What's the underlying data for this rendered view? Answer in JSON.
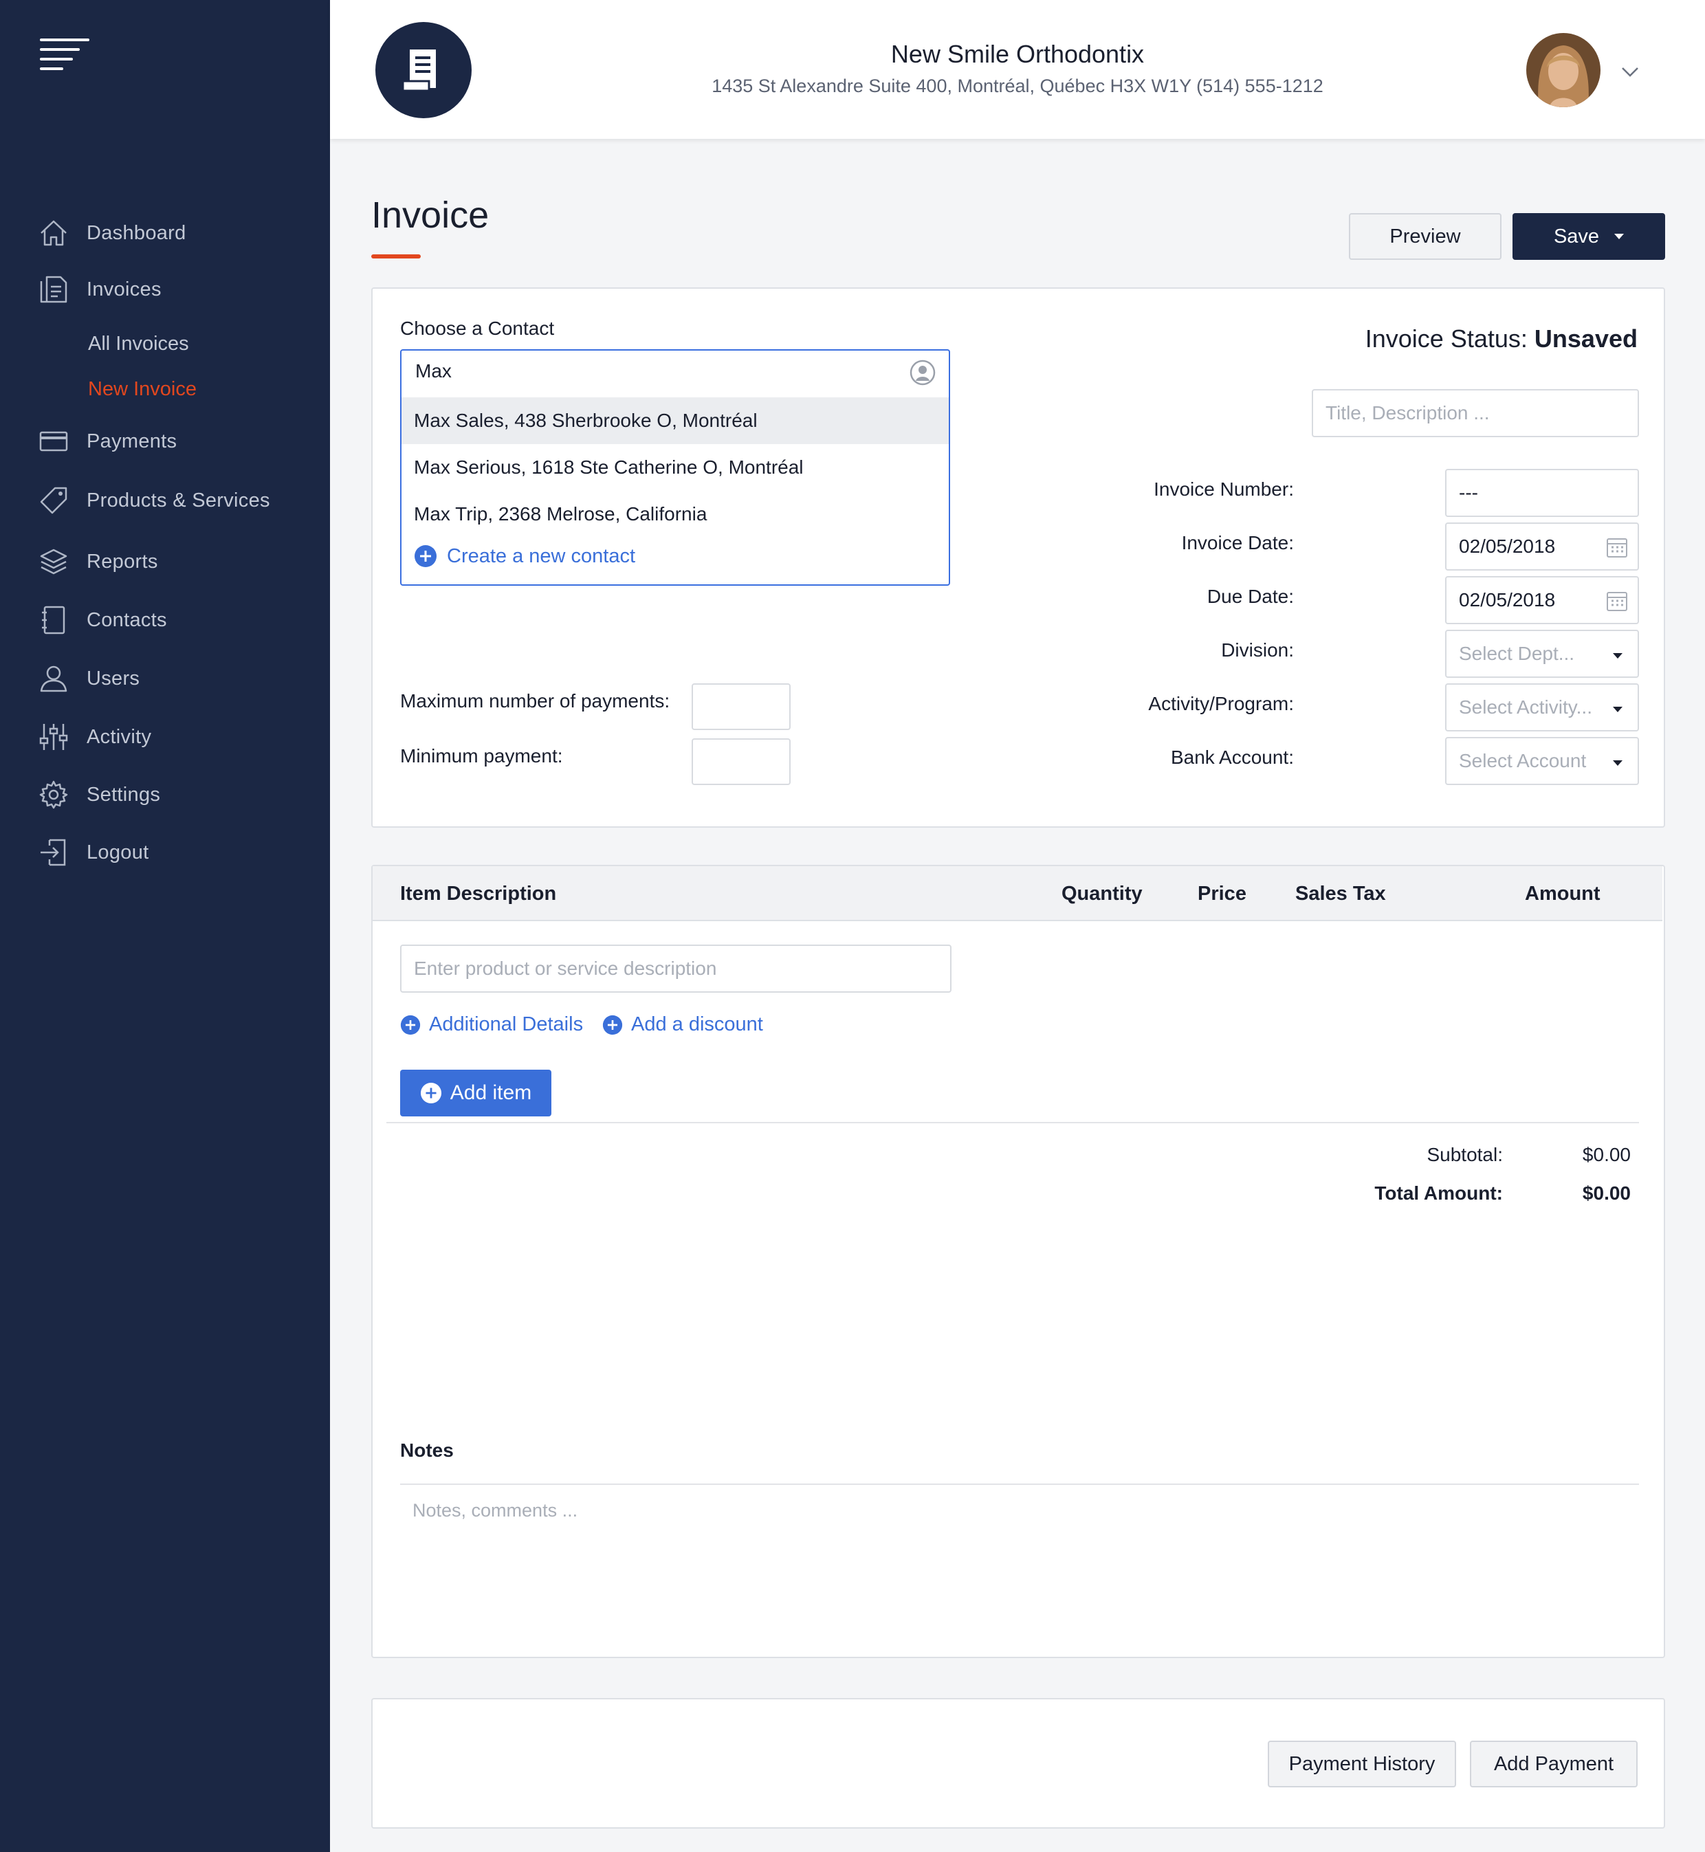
{
  "sidebar": {
    "items": [
      {
        "label": "Dashboard",
        "icon": "home-icon"
      },
      {
        "label": "Invoices",
        "icon": "invoices-icon"
      },
      {
        "label": "Payments",
        "icon": "credit-card-icon"
      },
      {
        "label": "Products & Services",
        "icon": "tag-icon"
      },
      {
        "label": "Reports",
        "icon": "layers-icon"
      },
      {
        "label": "Contacts",
        "icon": "address-book-icon"
      },
      {
        "label": "Users",
        "icon": "user-icon"
      },
      {
        "label": "Activity",
        "icon": "sliders-icon"
      },
      {
        "label": "Settings",
        "icon": "gear-icon"
      },
      {
        "label": "Logout",
        "icon": "logout-icon"
      }
    ],
    "sub_items": [
      {
        "label": "All Invoices",
        "active": false
      },
      {
        "label": "New Invoice",
        "active": true
      }
    ],
    "colors": {
      "background": "#1b2744",
      "active": "#e2471e"
    }
  },
  "header": {
    "company_name": "New Smile Orthodontix",
    "company_address": "1435 St Alexandre Suite 400, Montréal, Québec H3X W1Y (514) 555-1212"
  },
  "page": {
    "title": "Invoice",
    "preview_label": "Preview",
    "save_label": "Save"
  },
  "contact": {
    "label": "Choose a Contact",
    "query": "Max",
    "options": [
      "Max Sales, 438 Sherbrooke O, Montréal",
      "Max Serious, 1618 Ste Catherine O, Montréal",
      "Max Trip, 2368 Melrose, California"
    ],
    "create_label": "Create a new contact"
  },
  "payments_limits": {
    "max_label": "Maximum number of payments:",
    "min_label": "Minimum payment:",
    "max_value": "",
    "min_value": ""
  },
  "status": {
    "label": "Invoice Status:",
    "value": "Unsaved"
  },
  "fields": {
    "title_placeholder": "Title, Description ...",
    "invoice_number_label": "Invoice Number:",
    "invoice_number_value": "---",
    "invoice_date_label": "Invoice Date:",
    "invoice_date_value": "02/05/2018",
    "due_date_label": "Due Date:",
    "due_date_value": "02/05/2018",
    "division_label": "Division:",
    "division_placeholder": "Select Dept...",
    "activity_label": "Activity/Program:",
    "activity_placeholder": "Select Activity...",
    "bank_label": "Bank Account:",
    "bank_placeholder": "Select Account"
  },
  "items": {
    "columns": [
      "Item Description",
      "Quantity",
      "Price",
      "Sales Tax",
      "Amount"
    ],
    "description_placeholder": "Enter product or service description",
    "additional_details_label": "Additional Details",
    "discount_label": "Add a discount",
    "add_item_label": "Add item",
    "subtotal_label": "Subtotal:",
    "subtotal_value": "$0.00",
    "total_label": "Total Amount:",
    "total_value": "$0.00"
  },
  "notes": {
    "label": "Notes",
    "placeholder": "Notes, comments ..."
  },
  "footer": {
    "payment_history_label": "Payment History",
    "add_payment_label": "Add Payment"
  }
}
